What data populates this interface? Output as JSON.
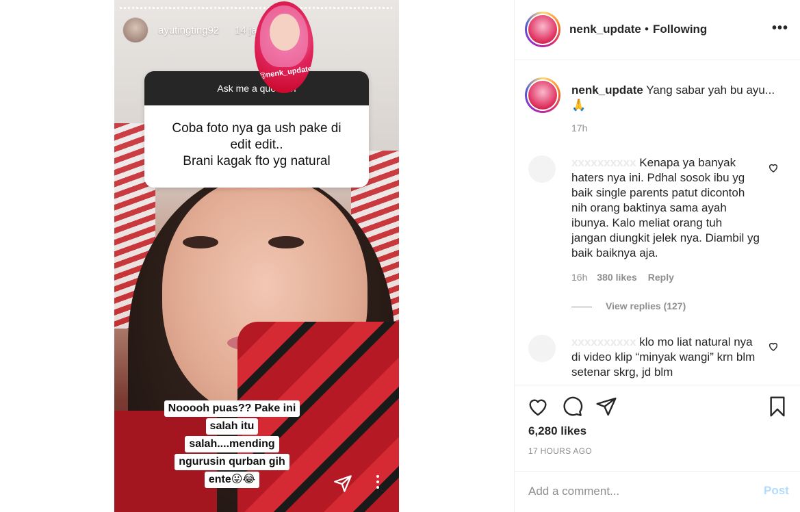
{
  "story": {
    "username": "ayutingting92",
    "time": "14 jam",
    "badge_text": "@nenk_update",
    "question_header": "Ask me a question",
    "question_lines": [
      "Coba foto nya ga ush pake di",
      "edit edit..",
      "Brani kagak fto yg natural"
    ],
    "caption_lines": [
      "Nooooh puas?? Pake ini",
      "salah itu",
      "salah....mending",
      "ngurusin qurban gih",
      "ente😛😂"
    ],
    "icons": {
      "send": "paper-plane-icon",
      "more": "vertical-dots-icon"
    }
  },
  "header": {
    "username": "nenk_update",
    "dot": "•",
    "follow_status": "Following",
    "more": "•••"
  },
  "caption": {
    "username": "nenk_update",
    "text": "Yang sabar yah bu ayu...",
    "emoji": "🙏",
    "time": "17h"
  },
  "comments": [
    {
      "username": "xxxxxxxxxx",
      "text": "Kenapa ya banyak haters nya ini. Pdhal sosok ibu yg baik single parents patut dicontoh nih orang baktinya sama ayah ibunya. Kalo meliat orang tuh jangan diungkit jelek nya. Diambil yg baik baiknya aja.",
      "time": "16h",
      "likes": "380 likes",
      "reply": "Reply",
      "view_replies": "View replies (127)"
    },
    {
      "username": "xxxxxxxxxx",
      "text": "klo mo liat natural nya di video klip “minyak wangi” krn blm setenar skrg, jd blm"
    }
  ],
  "actions": {
    "likes": "6,280 likes",
    "ago": "17 HOURS AGO"
  },
  "add_comment": {
    "placeholder": "Add a comment...",
    "post_label": "Post"
  },
  "colors": {
    "text": "#262626",
    "muted": "#8e8e8e",
    "post_disabled": "#b3dbff",
    "border": "#efefef"
  }
}
